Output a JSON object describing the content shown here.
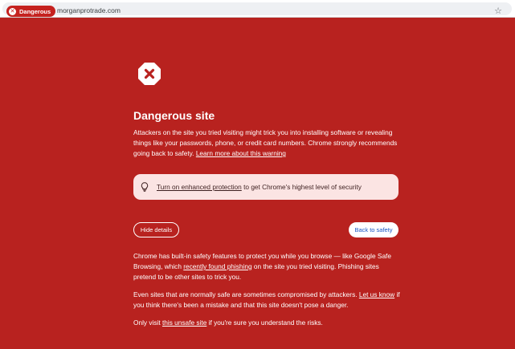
{
  "browser": {
    "security_chip_label": "Dangerous",
    "url": "morganprotrade.com",
    "chip_icon": "close-icon",
    "bookmark_icon": "star-icon"
  },
  "warning": {
    "icon": "stop-sign-icon",
    "title": "Dangerous site",
    "intro_text": "Attackers on the site you tried visiting might trick you into installing software or revealing things like your passwords, phone, or credit card numbers. Chrome strongly recommends going back to safety.",
    "learn_more_link": "Learn more about this warning",
    "enhanced_icon": "lightbulb-icon",
    "enhanced_link": "Turn on enhanced protection",
    "enhanced_text": "to get Chrome's highest level of security",
    "hide_details_label": "Hide details",
    "back_to_safety_label": "Back to safety"
  },
  "details": {
    "p1_before": "Chrome has built-in safety features to protect you while you browse — like Google Safe Browsing, which",
    "p1_link": "recently found phishing",
    "p1_after": "on the site you tried visiting. Phishing sites pretend to be other sites to trick you.",
    "p2_before": "Even sites that are normally safe are sometimes compromised by attackers.",
    "p2_link": "Let us know",
    "p2_after": "if you think there's been a mistake and that this site doesn't pose a danger.",
    "p3_before": "Only visit",
    "p3_link": "this unsafe site",
    "p3_after": "if you're sure you understand the risks."
  },
  "colors": {
    "background": "#b8221f",
    "chip": "#c5221f",
    "enhanced_box": "#fbe4e3",
    "back_button_text": "#1a56c4"
  }
}
